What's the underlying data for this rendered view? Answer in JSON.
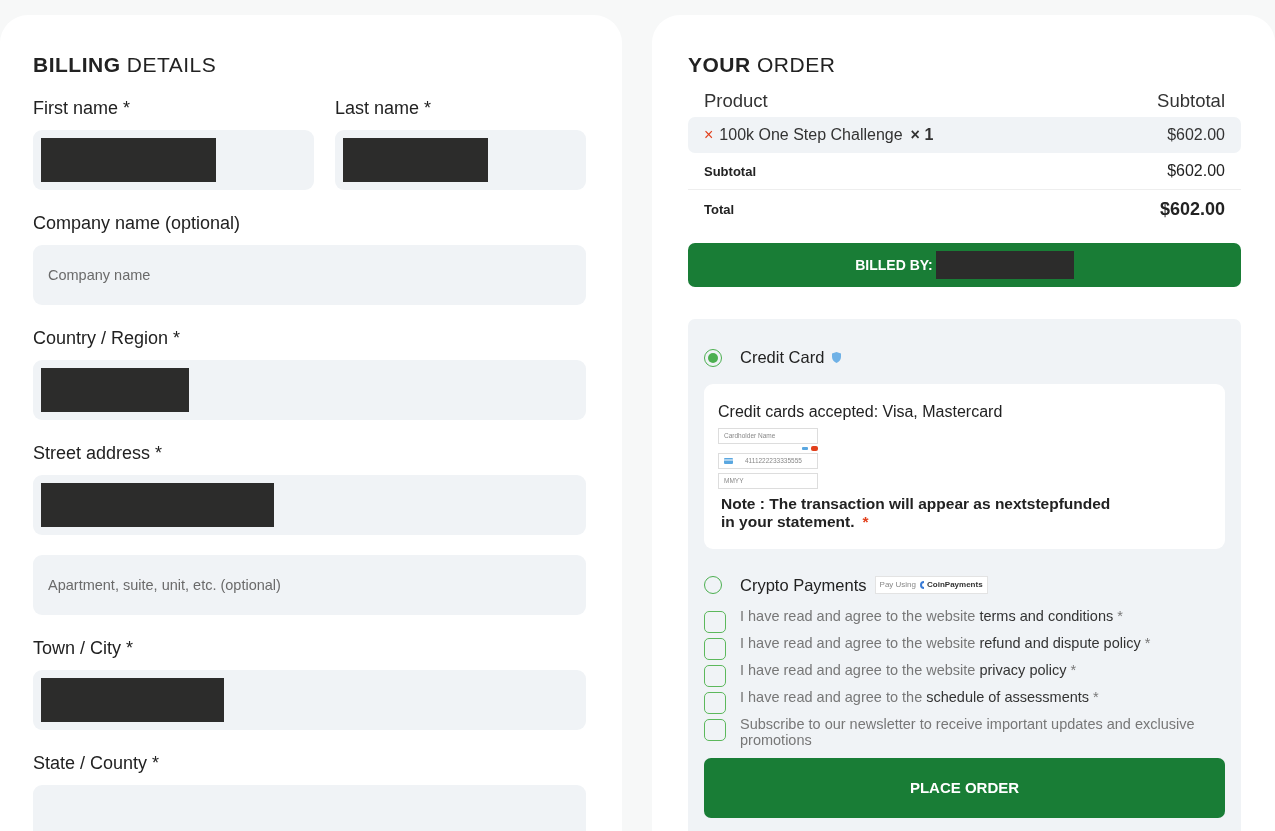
{
  "billing": {
    "title": "**BILLING** DETAILS",
    "rows": [
      [
        {
          "label": "First name *",
          "redacted": true
        },
        {
          "label": "Last name *",
          "redacted": true
        }
      ],
      [
        {
          "label": "Company name (optional)",
          "placeholder": "Company name"
        }
      ],
      [
        {
          "label": "Country / Region *",
          "redacted": true
        }
      ],
      [
        {
          "label": "Street address *",
          "redacted": true
        }
      ],
      [
        {
          "placeholder": "Apartment, suite, unit, etc. (optional)"
        }
      ],
      [
        {
          "label": "Town / City *",
          "redacted": true
        }
      ],
      [
        {
          "label": "State / County *"
        }
      ]
    ]
  },
  "order": {
    "title": "**YOUR** ORDER",
    "columns": [
      "Product",
      "Subtotal"
    ],
    "items": [
      {
        "remove": "×",
        "name": "100k One Step Challenge",
        "qty": "× 1",
        "price": "$602.00"
      }
    ],
    "subtotal": {
      "label": "Subtotal",
      "value": "$602.00"
    },
    "total": {
      "label": "Total",
      "value": "$602.00"
    },
    "billed_by": {
      "label": "BILLED BY:",
      "redacted": true
    },
    "payment_methods": [
      {
        "kind": "card",
        "label": "Credit Card",
        "selected": true,
        "accepted": "Credit cards accepted: Visa, Mastercard",
        "name_placeholder": "Cardholder Name",
        "card_number": "4111222233335555",
        "expiry_placeholder": "MMYY",
        "note_lines": [
          "Note : The transaction will appear as nextstepfunded",
          "in your statement."
        ],
        "note_mark": "*"
      },
      {
        "kind": "crypto",
        "label": "Crypto Payments",
        "selected": false,
        "badge_prefix": "Pay Using",
        "badge_brand": "CoinPayments"
      }
    ],
    "agreements": [
      {
        "text": "I have read and agree to the website",
        "link": "terms and conditions",
        "mark": "*",
        "checked": false
      },
      {
        "text": "I have read and agree to the website",
        "link": "refund and dispute policy",
        "mark": "*",
        "checked": false
      },
      {
        "text": "I have read and agree to the website",
        "link": "privacy policy",
        "mark": "*",
        "checked": false
      },
      {
        "text": "I have read and agree to the",
        "link": "schedule of assessments",
        "mark": "*",
        "checked": false
      },
      {
        "text": "Subscribe to our newsletter to receive important updates and exclusive promotions",
        "checked": false
      }
    ],
    "button": "PLACE ORDER"
  }
}
